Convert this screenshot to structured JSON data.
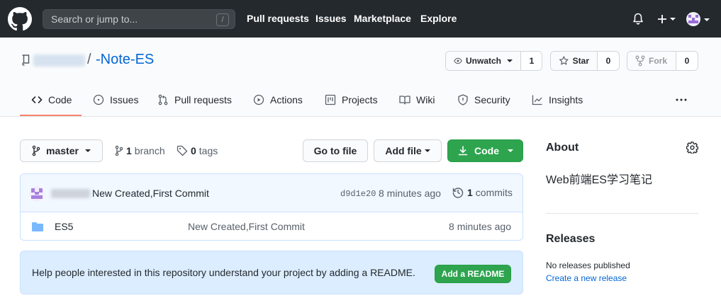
{
  "header": {
    "search_placeholder": "Search or jump to...",
    "search_shortcut": "/",
    "nav": [
      "Pull requests",
      "Issues",
      "Marketplace",
      "Explore"
    ]
  },
  "repo": {
    "slash": "/",
    "name": "-Note-ES",
    "watch": {
      "label": "Unwatch",
      "count": "1"
    },
    "star": {
      "label": "Star",
      "count": "0"
    },
    "fork": {
      "label": "Fork",
      "count": "0"
    }
  },
  "tabs": [
    {
      "label": "Code",
      "icon": "code-icon"
    },
    {
      "label": "Issues",
      "icon": "issue-icon"
    },
    {
      "label": "Pull requests",
      "icon": "pull-request-icon"
    },
    {
      "label": "Actions",
      "icon": "play-icon"
    },
    {
      "label": "Projects",
      "icon": "project-icon"
    },
    {
      "label": "Wiki",
      "icon": "book-icon"
    },
    {
      "label": "Security",
      "icon": "shield-icon"
    },
    {
      "label": "Insights",
      "icon": "graph-icon"
    }
  ],
  "toolbar": {
    "branch_label": "master",
    "branch_count": "1",
    "branch_word": "branch",
    "tag_count": "0",
    "tag_word": "tags",
    "go_to_file": "Go to file",
    "add_file": "Add file",
    "code": "Code"
  },
  "commit": {
    "message": "New Created,First Commit",
    "sha": "d9d1e20",
    "time": "8 minutes ago",
    "count": "1",
    "count_word": "commits"
  },
  "files": [
    {
      "name": "ES5",
      "message": "New Created,First Commit",
      "time": "8 minutes ago",
      "type": "folder"
    }
  ],
  "readme": {
    "text": "Help people interested in this repository understand your project by adding a README.",
    "button": "Add a README"
  },
  "sidebar": {
    "about_title": "About",
    "description": "Web前端ES学习笔记",
    "releases_title": "Releases",
    "no_releases": "No releases published",
    "create_release": "Create a new release"
  },
  "colors": {
    "header_bg": "#24292e",
    "link": "#0366d6",
    "green": "#2ea44f",
    "tab_underline": "#f9826c"
  }
}
